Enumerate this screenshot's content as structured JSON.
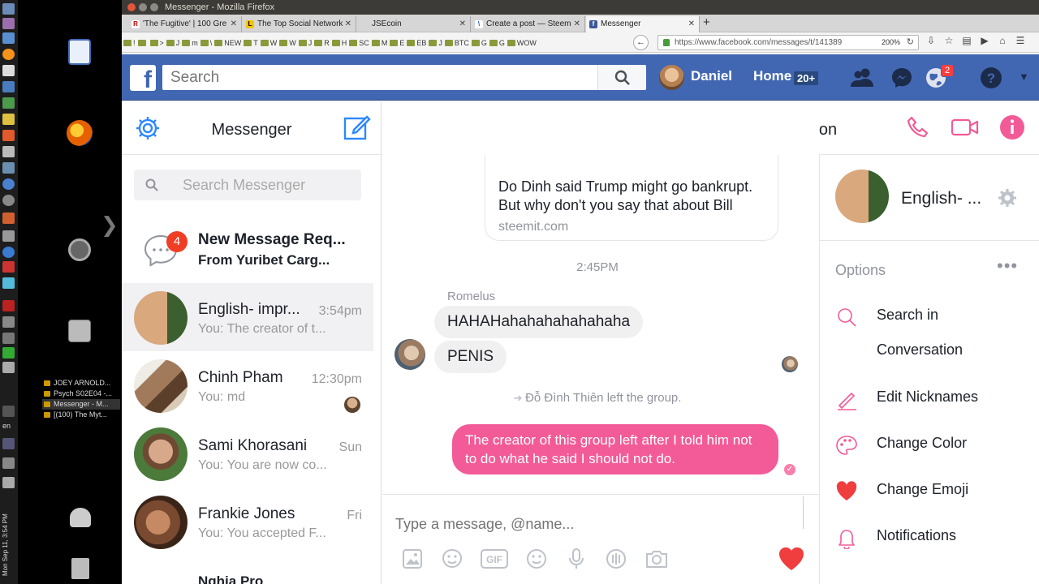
{
  "window": {
    "title": "Messenger - Mozilla Firefox"
  },
  "tabs": [
    {
      "label": "'The Fugitive' | 100 Gre",
      "favicon": "R"
    },
    {
      "label": "The Top Social Network",
      "favicon": "L"
    },
    {
      "label": "JSEcoin",
      "favicon": ""
    },
    {
      "label": "Create a post — Steem",
      "favicon": "\\"
    },
    {
      "label": "Messenger",
      "favicon": "f"
    }
  ],
  "bookmarks": [
    "!",
    "",
    ">",
    "J",
    "m",
    "\\",
    "NEW",
    "T",
    "W",
    "W",
    "J",
    "R",
    "H",
    "SC",
    "M",
    "E",
    "EB",
    "J",
    "BTC",
    "G",
    "G",
    "WOW"
  ],
  "url": {
    "value": "https://www.facebook.com/messages/t/141389",
    "zoom": "200%"
  },
  "desktop": {
    "windows": [
      "JOEY ARNOLD...",
      "Psych S02E04 -...",
      "Messenger - M...",
      "[(100) The Myt..."
    ],
    "lang": "en",
    "clock": "Mon Sep 11, 3:54 PM"
  },
  "fb": {
    "search_placeholder": "Search",
    "user_name": "Daniel",
    "home_label": "Home",
    "home_count": "20+",
    "notif_count": "2",
    "colors": {
      "brand": "#4267b2",
      "accent": "#f25b97"
    }
  },
  "messenger": {
    "title": "Messenger",
    "search_placeholder": "Search Messenger",
    "request": {
      "count": "4",
      "line1": "New Message Req...",
      "line2": "From Yuribet Carg..."
    },
    "conversations": [
      {
        "name": "English- impr...",
        "time": "3:54pm",
        "preview": "You: The creator of t..."
      },
      {
        "name": "Chinh Pham",
        "time": "12:30pm",
        "preview": "You: md"
      },
      {
        "name": "Sami Khorasani",
        "time": "Sun",
        "preview": "You: You are now co..."
      },
      {
        "name": "Frankie Jones",
        "time": "Fri",
        "preview": "You: You accepted F..."
      }
    ],
    "last_partial": "Nghia Pro"
  },
  "chat": {
    "title": "English- improvement conversation",
    "link_card": {
      "text": "Do Dinh said Trump might go bankrupt. But why don't you say that about Bill",
      "domain": "steemit.com"
    },
    "timestamp": "2:45PM",
    "sender": "Romelus",
    "messages": [
      "HAHAHahahahahahahaha",
      "PENIS"
    ],
    "left_notice": "Đỗ Đình Thiên left the group.",
    "my_message": "The creator of this group left after I told him not to do what he said I should not do.",
    "composer_placeholder": "Type a message, @name..."
  },
  "info": {
    "group_name": "English- ...",
    "options_label": "Options",
    "options": [
      {
        "label": "Search in Conversation",
        "icon": "search-icon"
      },
      {
        "label": "Edit Nicknames",
        "icon": "pencil-icon"
      },
      {
        "label": "Change Color",
        "icon": "palette-icon"
      },
      {
        "label": "Change Emoji",
        "icon": "heart-icon"
      },
      {
        "label": "Notifications",
        "icon": "bell-icon"
      }
    ]
  }
}
